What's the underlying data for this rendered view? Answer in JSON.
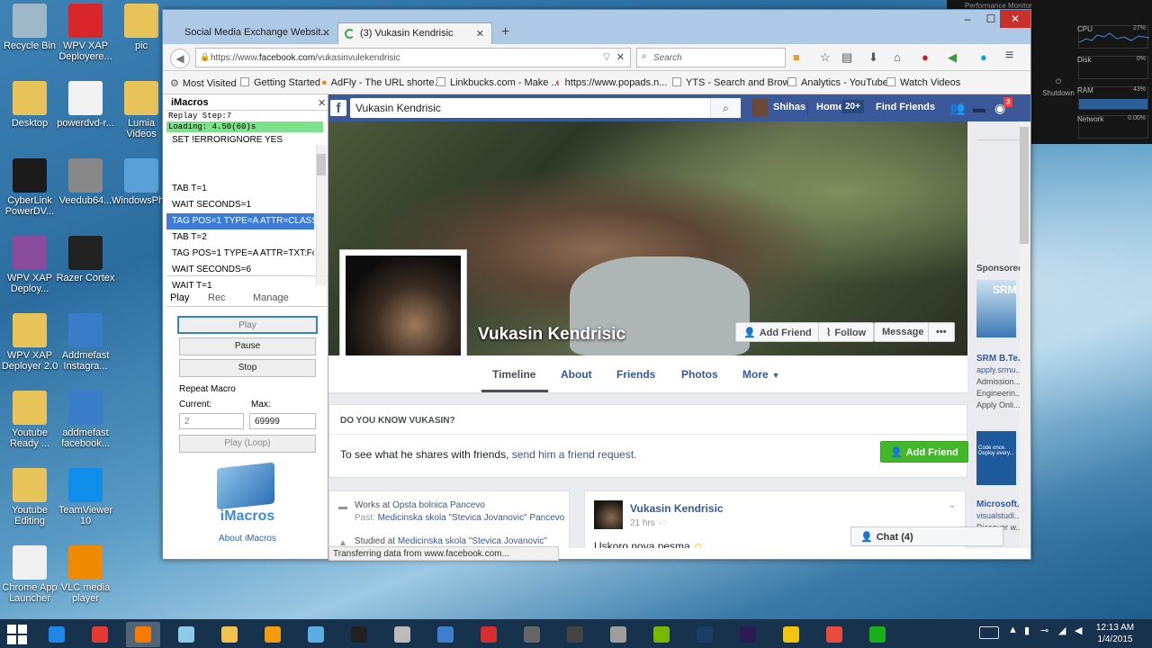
{
  "desktop": {
    "icons": [
      {
        "label": "Recycle Bin",
        "color": "#9fb8c8"
      },
      {
        "label": "WPV XAP Deployere...",
        "color": "#d9262b"
      },
      {
        "label": "pic",
        "color": "#e8c35a"
      },
      {
        "label": "Desktop",
        "color": "#e8c35a"
      },
      {
        "label": "powerdvd-r...",
        "color": "#f2f2f2"
      },
      {
        "label": "Lumia Videos",
        "color": "#e8c35a"
      },
      {
        "label": "CyberLink PowerDV...",
        "color": "#1b1b1b"
      },
      {
        "label": "Veedub64...",
        "color": "#888888"
      },
      {
        "label": "WindowsPh...",
        "color": "#5aa0d8"
      },
      {
        "label": "WPV XAP Deploy...",
        "color": "#8b4b9c"
      },
      {
        "label": "Razer Cortex",
        "color": "#222222"
      },
      {
        "label": "WPV XAP Deployer 2.0",
        "color": "#e8c35a"
      },
      {
        "label": "Addmefast Instagra...",
        "color": "#3a7cc8"
      },
      {
        "label": "Youtube Ready ...",
        "color": "#e8c35a"
      },
      {
        "label": "addmefast facebook...",
        "color": "#3a7cc8"
      },
      {
        "label": "Youtube Editing",
        "color": "#e8c35a"
      },
      {
        "label": "TeamViewer 10",
        "color": "#0e8ee9"
      },
      {
        "label": "Chrome App Launcher",
        "color": "#f0f0f0"
      },
      {
        "label": "VLC media player",
        "color": "#f08a00"
      }
    ]
  },
  "perf": {
    "title": "Performance Monitor",
    "cpu_label": "CPU",
    "cpu_val": "27%",
    "disk_label": "Disk",
    "disk_val": "0%",
    "ram_label": "RAM",
    "ram_val": "43%",
    "net_label": "Network",
    "net_val": "0.00%",
    "shutdown": "Shutdown"
  },
  "browser": {
    "tabs": [
      {
        "label": "Social Media Exchange Websit...",
        "active": false
      },
      {
        "label": "(3) Vukasin Kendrisic",
        "active": true
      }
    ],
    "url_prefix": "https://www.",
    "url_domain": "facebook.com",
    "url_path": "/vukasinvulekendrisic",
    "search_placeholder": "Search",
    "bookmarks": [
      "Most Visited",
      "Getting Started",
      "AdFly - The URL shorte...",
      "Linkbucks.com - Make ...",
      "https://www.popads.n...",
      "YTS - Search and Brow...",
      "Analytics - YouTube",
      "Watch Videos"
    ],
    "status": "Transferring data from www.facebook.com..."
  },
  "imacros": {
    "title": "iMacros",
    "replay_step": "Replay Step:7",
    "loading": "Loading: 4.50(60)s",
    "lines": [
      "SET !ERRORIGNORE YES",
      "",
      "",
      "TAB T=1",
      "WAIT SECONDS=1",
      "TAG POS=1 TYPE=A ATTR=CLASS...",
      "TAB T=2",
      "TAG POS=1 TYPE=A ATTR=TXT:Fo...",
      "WAIT SECONDS=6",
      "WAIT T=1"
    ],
    "selected_line": 5,
    "tabs": [
      "Play",
      "Rec",
      "Manage"
    ],
    "play": "Play",
    "pause": "Pause",
    "stop": "Stop",
    "repeat_title": "Repeat Macro",
    "current_label": "Current:",
    "max_label": "Max:",
    "current_value": "2",
    "max_value": "69999",
    "play_loop": "Play (Loop)",
    "logo_text": "iMacros",
    "about": "About iMacros"
  },
  "facebook": {
    "search_value": "Vukasin Kendrisic",
    "user": "Shihas",
    "home": "Home",
    "home_count": "20+",
    "find_friends": "Find Friends",
    "notif_count": "3",
    "profile_name": "Vukasin Kendrisic",
    "buttons": {
      "add_friend": "Add Friend",
      "follow": "Follow",
      "message": "Message",
      "more": "•••"
    },
    "tabs": [
      "Timeline",
      "About",
      "Friends",
      "Photos",
      "More"
    ],
    "know_title": "DO YOU KNOW VUKASIN?",
    "know_text": "To see what he shares with friends, ",
    "know_link": "send him a friend request.",
    "add_friend_cta": "Add Friend",
    "works_prefix": "Works at ",
    "works_place": "Opsta bolnica Pancevo",
    "past_prefix": "Past: ",
    "past_place": "Medicinska skola \"Stevica Jovanovic\" Pancevo",
    "studied_prefix": "Studied at ",
    "studied_place": "Medicinska skola \"Stevica Jovanovic\"",
    "post_author": "Vukasin Kendrisic",
    "post_time": "21 hrs",
    "post_text": "Uskoro nova pesma",
    "chat": "Chat (4)",
    "sponsored": "Sponsored",
    "ad1_title": "SRM B.Te...",
    "ad1_l1": "apply.srmu...",
    "ad1_l2": "Admission...",
    "ad1_l3": "Engineerin...",
    "ad1_l4": "Apply Onli...",
    "ad2_title": "Microsoft...",
    "ad2_l1": "visualstudi...",
    "ad2_l2": "Discover w...",
    "ad2_banner": "Code once. Deploy every...",
    "ad1_banner": "SRM"
  },
  "taskbar": {
    "time": "12:13 AM",
    "date": "1/4/2015",
    "apps": [
      {
        "name": "ie-icon",
        "color": "#1e88e5"
      },
      {
        "name": "chrome-icon",
        "color": "#e53935"
      },
      {
        "name": "firefox-icon",
        "color": "#f57c00"
      },
      {
        "name": "windows-app-icon",
        "color": "#8ec9e8"
      },
      {
        "name": "explorer-icon",
        "color": "#f2c14e"
      },
      {
        "name": "media-icon",
        "color": "#f39c12"
      },
      {
        "name": "control-panel-icon",
        "color": "#5dade2"
      },
      {
        "name": "player-icon",
        "color": "#222222"
      },
      {
        "name": "snipping-icon",
        "color": "#bbbbbb"
      },
      {
        "name": "network-icon",
        "color": "#3f7fd0"
      },
      {
        "name": "opera-icon",
        "color": "#d32f2f"
      },
      {
        "name": "monitor-icon",
        "color": "#666666"
      },
      {
        "name": "phone-icon",
        "color": "#444444"
      },
      {
        "name": "calculator-icon",
        "color": "#9e9e9e"
      },
      {
        "name": "nvidia-icon",
        "color": "#76b900"
      },
      {
        "name": "photoshop-icon",
        "color": "#1d3c63"
      },
      {
        "name": "after-effects-icon",
        "color": "#2c1b52"
      },
      {
        "name": "folder-sync-icon",
        "color": "#f1c40f"
      },
      {
        "name": "apps-grid-icon",
        "color": "#e74c3c"
      },
      {
        "name": "razer-icon",
        "color": "#1aaf1a"
      }
    ]
  }
}
